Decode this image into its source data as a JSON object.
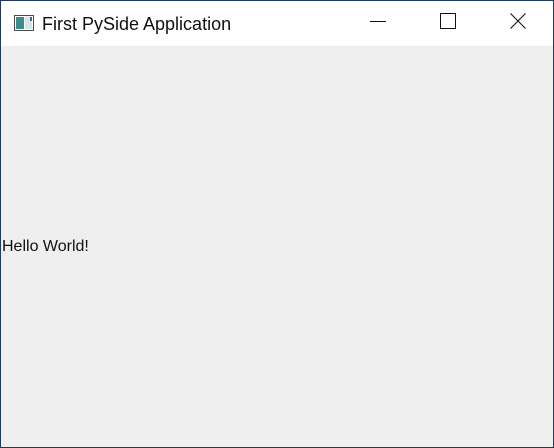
{
  "window": {
    "title": "First PySide Application",
    "icon": "app-window-icon",
    "controls": {
      "minimize_icon": "minimize-icon",
      "maximize_icon": "maximize-icon",
      "close_icon": "close-icon"
    }
  },
  "content": {
    "label_text": "Hello World!"
  },
  "colors": {
    "titlebar_bg": "#ffffff",
    "client_bg": "#efefef",
    "window_border": "#1f3a5f",
    "text": "#111111"
  }
}
